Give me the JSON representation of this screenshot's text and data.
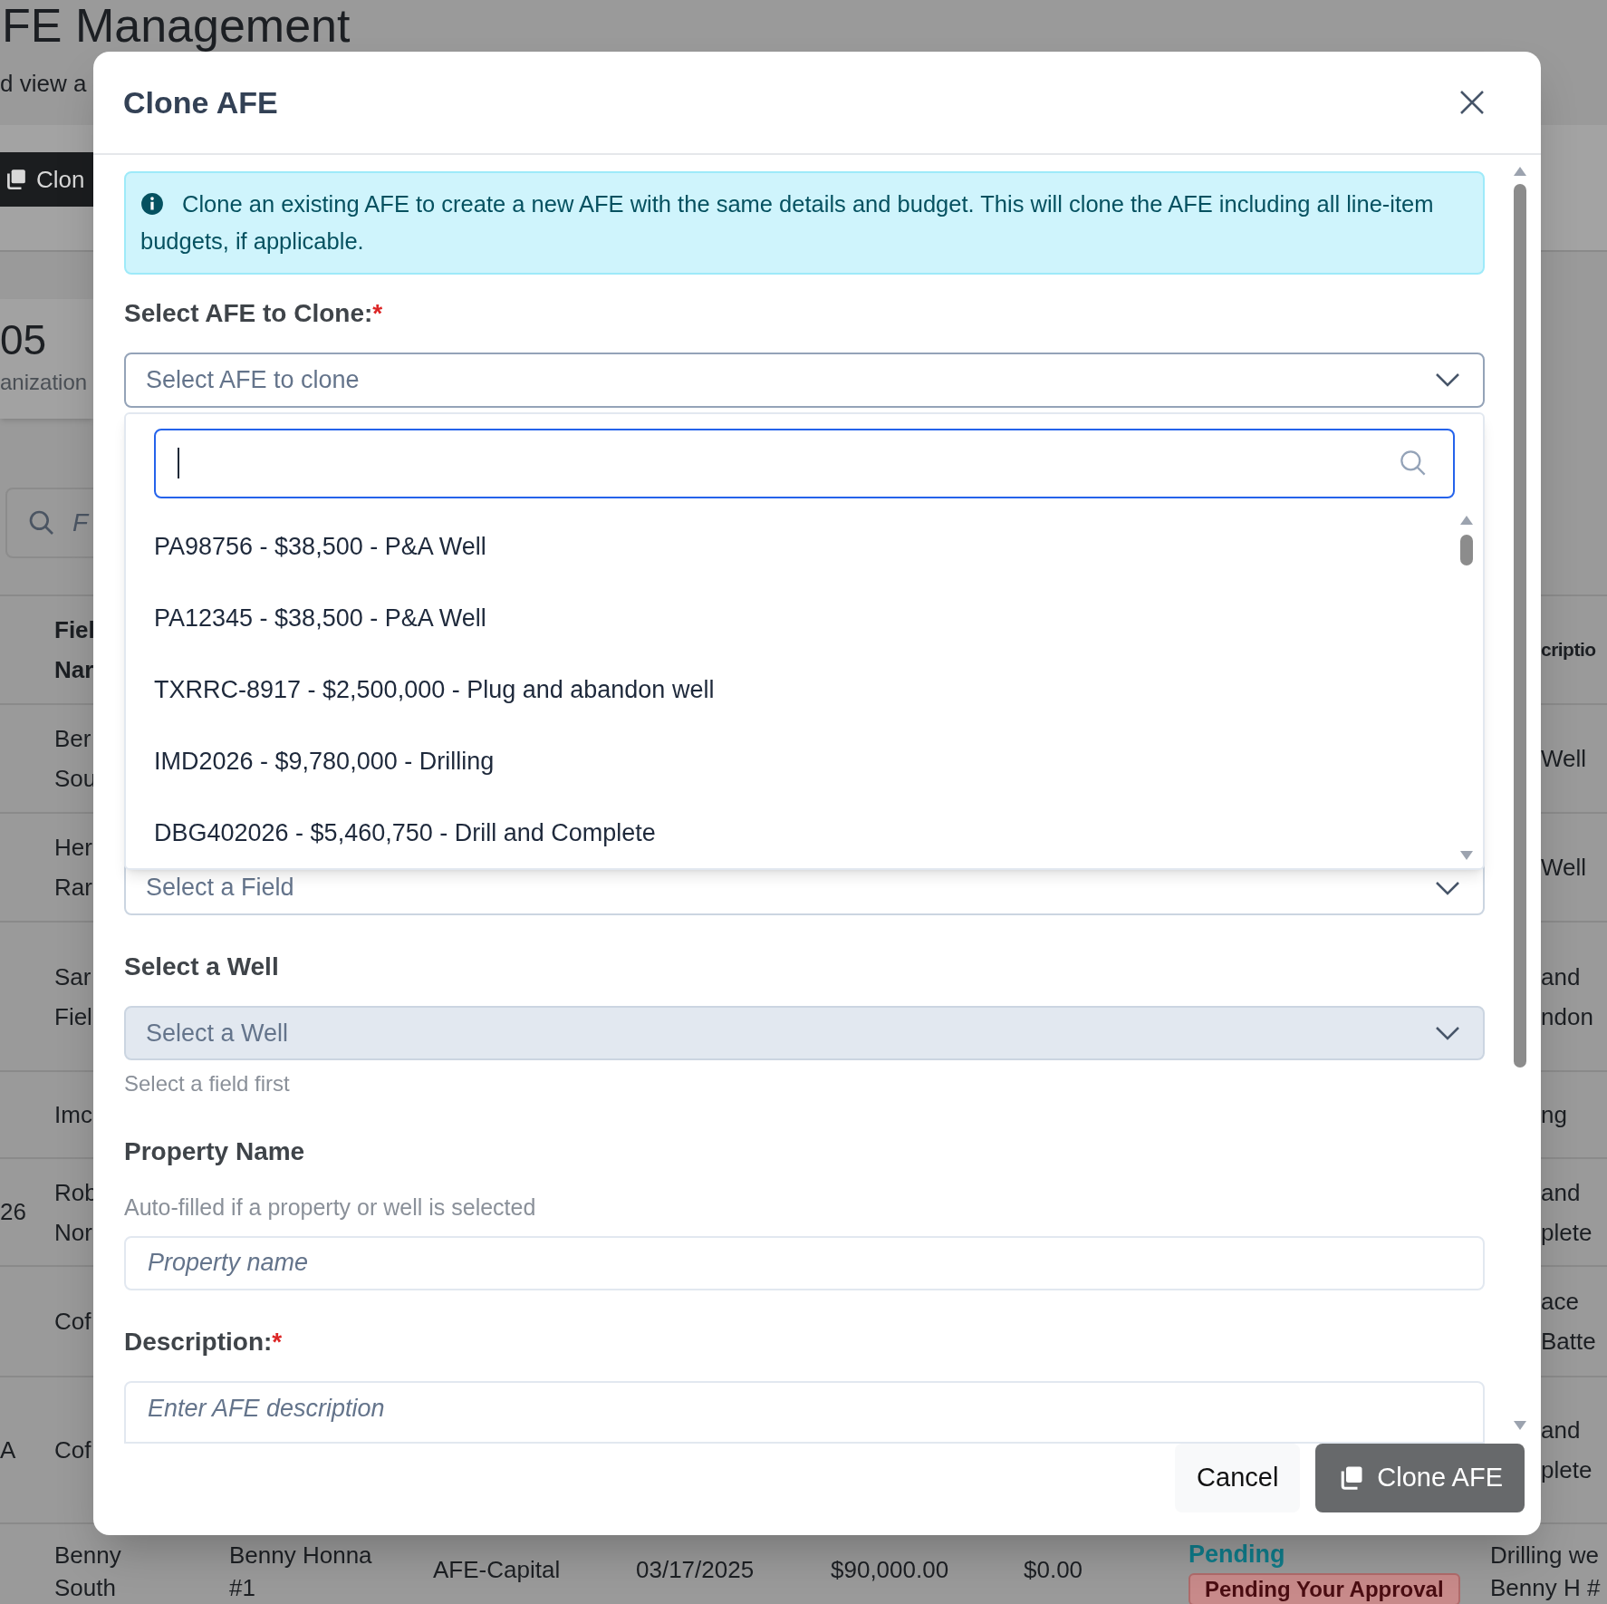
{
  "background": {
    "title": "FE Management",
    "subtitle": "d view a",
    "toolbar_button": "Clon",
    "stat_card": {
      "value": "05",
      "label": "anization"
    },
    "search": {
      "placeholder": "F"
    },
    "table": {
      "left_header": [
        "Fiel",
        "Nar"
      ],
      "right_header": [
        "criptio"
      ],
      "rows": [
        {
          "left_cut": "",
          "left": [
            "Ber",
            "Sou"
          ],
          "right": [
            "Well"
          ]
        },
        {
          "left_cut": "",
          "left": [
            "Her",
            "Rar"
          ],
          "right": [
            "Well"
          ]
        },
        {
          "left_cut": "",
          "left": [
            "Sar",
            "Fiel"
          ],
          "right": [
            "and",
            "ndon"
          ]
        },
        {
          "left_cut": "",
          "left": [
            "Imc"
          ],
          "right": [
            "ng"
          ]
        },
        {
          "left_cut": "26",
          "left": [
            "Rob",
            "Nor"
          ],
          "right": [
            "and",
            "plete"
          ]
        },
        {
          "left_cut": "",
          "left": [
            "Cof"
          ],
          "right": [
            "ace",
            "Batte"
          ]
        },
        {
          "left_cut": "A",
          "left": [
            "Cof"
          ],
          "right": [
            "and",
            "plete"
          ]
        }
      ],
      "last_row": {
        "cells": [
          [
            "Benny",
            "South"
          ],
          [
            "Benny Honna",
            "#1"
          ],
          [
            "AFE-Capital"
          ],
          [
            "03/17/2025"
          ],
          [
            "$90,000.00"
          ],
          [
            "$0.00"
          ]
        ],
        "status": "Pending",
        "status_badge": "Pending Your Approval",
        "description": [
          "Drilling we",
          "Benny H #"
        ]
      }
    }
  },
  "dialog": {
    "title": "Clone AFE",
    "info": "Clone an existing AFE to create a new AFE with the same details and budget. This will clone the AFE including all line-item budgets, if applicable.",
    "afe_select": {
      "label": "Select AFE to Clone:",
      "required_mark": "*",
      "placeholder": "Select AFE to clone",
      "open": true,
      "options": [
        {
          "label": "PA98756 - $38,500 - P&A Well",
          "selected": false
        },
        {
          "label": "PA12345 - $38,500 - P&A Well",
          "selected": false
        },
        {
          "label": "TXRRC-8917 - $2,500,000 - Plug and abandon well",
          "selected": false
        },
        {
          "label": "IMD2026 - $9,780,000 - Drilling",
          "selected": false
        },
        {
          "label": "DBG402026 - $5,460,750 - Drill and Complete",
          "selected": false
        }
      ]
    },
    "field_select": {
      "placeholder": "Select a Field",
      "disabled": false
    },
    "well_select": {
      "label": "Select a Well",
      "placeholder": "Select a Well",
      "disabled": true,
      "help": "Select a field first"
    },
    "property_name": {
      "label": "Property Name",
      "hint": "Auto-filled if a property or well is selected",
      "placeholder": "Property name"
    },
    "description": {
      "label": "Description:",
      "required_mark": "*",
      "placeholder": "Enter AFE description"
    },
    "buttons": [
      {
        "label": "Cancel",
        "kind": "secondary"
      },
      {
        "label": "Clone AFE",
        "kind": "primary"
      }
    ]
  }
}
